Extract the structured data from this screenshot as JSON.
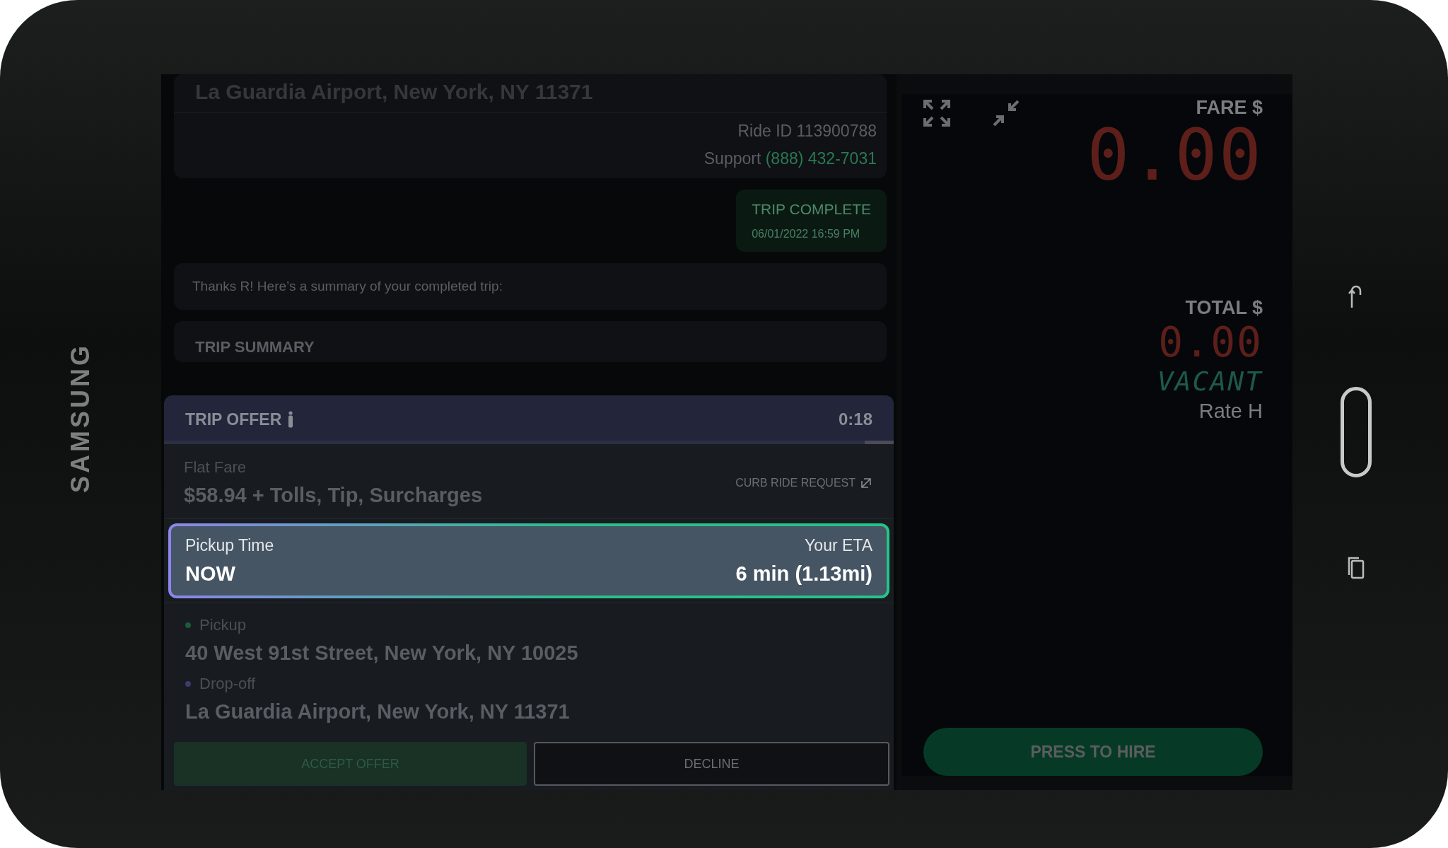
{
  "device": {
    "brand": "SAMSUNG"
  },
  "chat": {
    "address": "La Guardia Airport, New York, NY 11371",
    "ride_id": "Ride ID 113900788",
    "support_label": "Support",
    "support_phone": "(888) 432-7031",
    "status": {
      "title": "TRIP COMPLETE",
      "time": "06/01/2022 16:59 PM"
    },
    "message": "Thanks R! Here’s a summary of your completed trip:",
    "summary_title": "TRIP SUMMARY"
  },
  "offer": {
    "title": "TRIP OFFER",
    "countdown": "0:18",
    "level": 0.04,
    "fare_label": "Flat Fare",
    "fare": "$58.94 + Tolls, Tip, Surcharges",
    "request_type": "CURB RIDE REQUEST",
    "pickup_time_label": "Pickup Time",
    "pickup_time": "NOW",
    "eta_label": "Your ETA",
    "eta": "6 min (1.13mi)",
    "stops": [
      {
        "label": "Pickup",
        "color": "#1d5a3c",
        "address": "40 West 91st Street, New York, NY 10025"
      },
      {
        "label": "Drop-off",
        "color": "#3b3d6b",
        "address": "La Guardia Airport, New York, NY 11371"
      }
    ],
    "buttons": [
      {
        "label": "ACCEPT OFFER",
        "kind": "primary"
      },
      {
        "label": "DECLINE",
        "kind": "outline"
      }
    ]
  },
  "meter": {
    "fare_label": "FARE $",
    "fare": "0.00",
    "total_label": "TOTAL $",
    "total": "0.00",
    "status": "VACANT",
    "rate": "Rate H",
    "hire_button": "PRESS TO HIRE"
  }
}
